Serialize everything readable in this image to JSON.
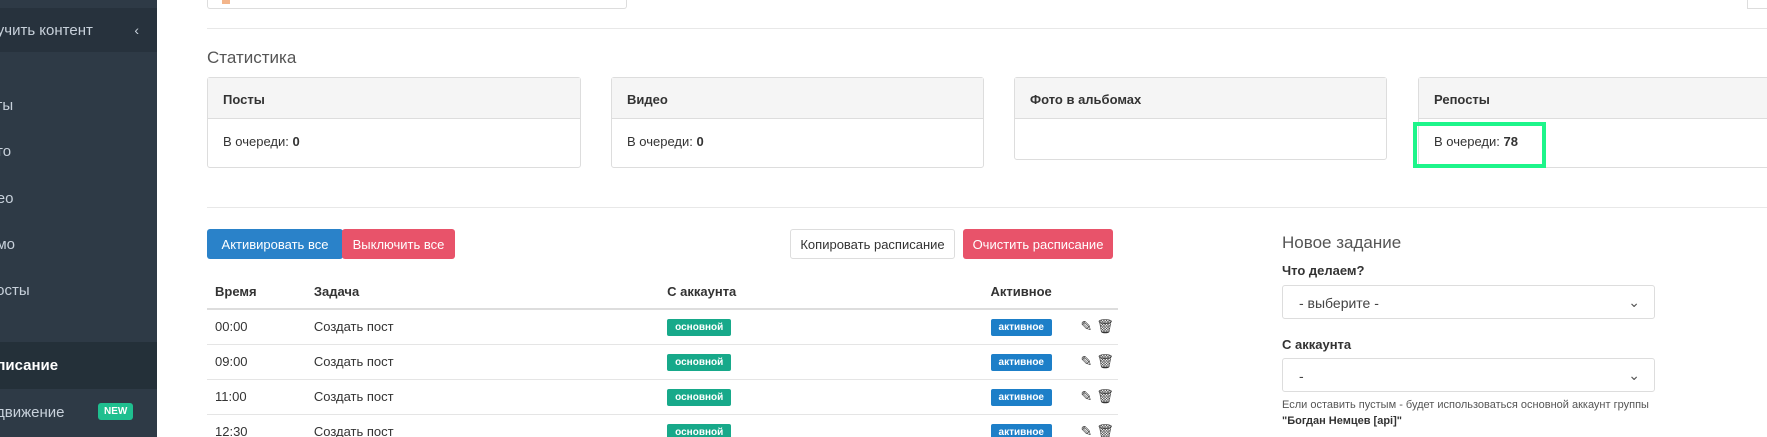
{
  "sidebar": {
    "top_item": "лучить контент",
    "items": [
      {
        "label": "сты"
      },
      {
        "label": "ото"
      },
      {
        "label": "део"
      },
      {
        "label": "омо"
      },
      {
        "label": "посты"
      }
    ],
    "active_item": "списание",
    "promo_item": "одвижение",
    "promo_badge": "NEW"
  },
  "statistics": {
    "title": "Статистика",
    "queue_label": "В очереди:",
    "cards": [
      {
        "title": "Посты",
        "queue": "0"
      },
      {
        "title": "Видео",
        "queue": "0"
      },
      {
        "title": "Фото в альбомах"
      },
      {
        "title": "Репосты",
        "queue": "78"
      }
    ]
  },
  "schedule": {
    "activate_all": "Активировать все",
    "disable_all": "Выключить все",
    "copy_schedule": "Копировать расписание",
    "clear_schedule": "Очистить расписание",
    "columns": [
      "Время",
      "Задача",
      "С аккаунта",
      "Активное"
    ],
    "rows": [
      {
        "time": "00:00",
        "task": "Создать пост",
        "account": "основной",
        "active": "активное"
      },
      {
        "time": "09:00",
        "task": "Создать пост",
        "account": "основной",
        "active": "активное"
      },
      {
        "time": "11:00",
        "task": "Создать пост",
        "account": "основной",
        "active": "активное"
      },
      {
        "time": "12:30",
        "task": "Создать пост",
        "account": "основной",
        "active": "активное"
      }
    ]
  },
  "new_task": {
    "title": "Новое задание",
    "what_label": "Что делаем?",
    "what_value": "- выберите -",
    "account_label": "С аккаунта",
    "account_value": "-",
    "help_text": "Если оставить пустым - будет использоваться основной аккаунт группы",
    "help_group": "\"Богдан Немцев [api]\""
  },
  "colors": {
    "sidebar_bg": "#2e3a46",
    "accent_blue": "#2a82c9",
    "accent_red": "#e8536a",
    "tag_green": "#17a98a",
    "highlight": "#1df58a"
  }
}
